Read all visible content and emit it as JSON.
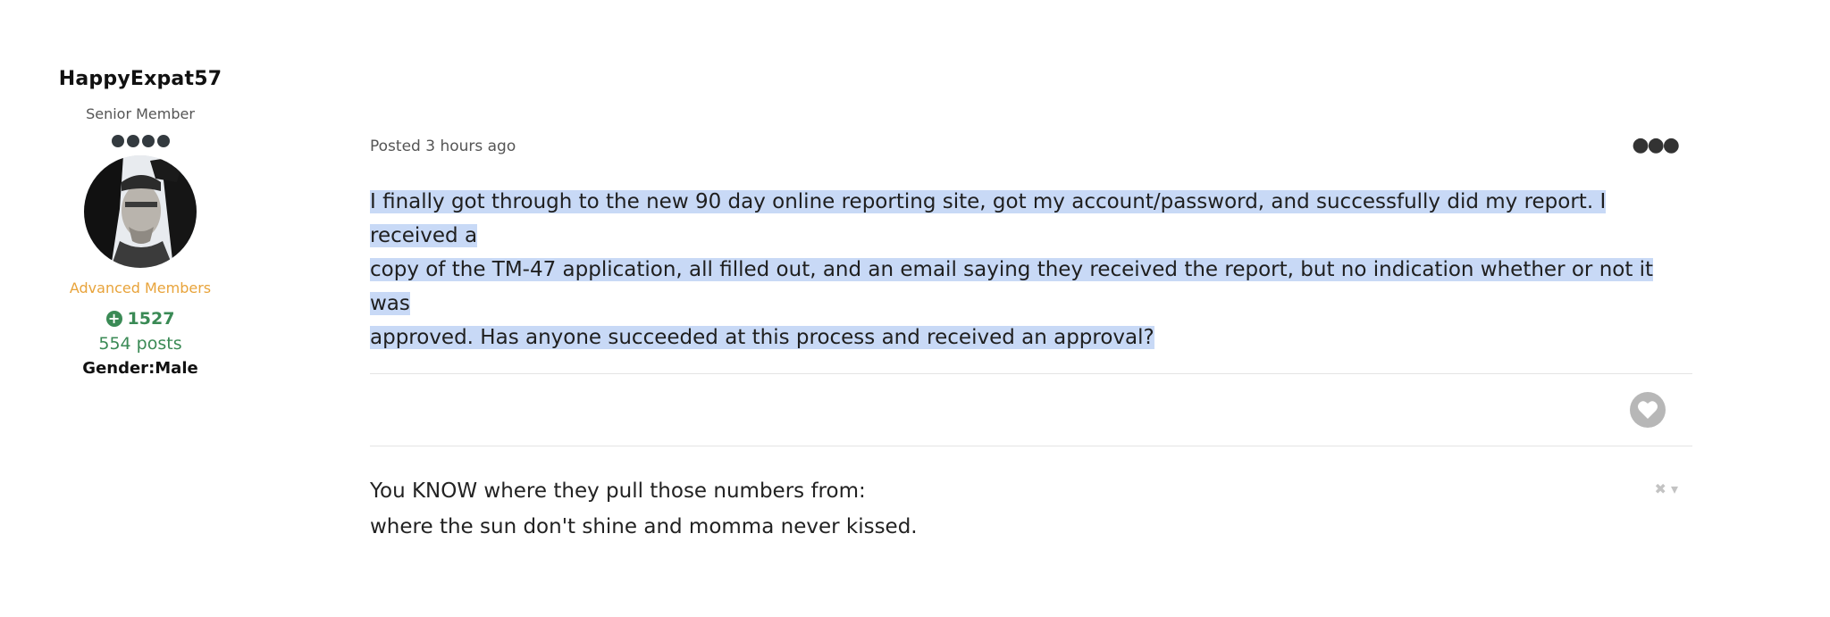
{
  "author": {
    "name": "HappyExpat57",
    "rank": "Senior Member",
    "rank_pips": 4,
    "group": "Advanced Members",
    "reputation": "1527",
    "posts": "554 posts",
    "gender": "Gender:Male"
  },
  "post": {
    "posted": "Posted 3 hours ago",
    "menu_icon": "ellipsis-icon",
    "body_lines": [
      "I finally got through to the new 90 day online reporting site, got my account/password, and successfully did my report. I received a",
      "copy of the TM-47 application, all filled out, and an email saying they received the report, but no indication whether or not it was",
      "approved. Has anyone succeeded at this process and received an approval?"
    ],
    "like_icon": "heart-icon",
    "selection_color": "#c8d9f6"
  },
  "signature": {
    "lines": [
      "You KNOW where they pull those numbers from:",
      "where the sun don't shine and momma never kissed."
    ],
    "toggle_label": "✖ ▾"
  },
  "colors": {
    "reputation": "#3a8a55",
    "group": "#e8a33a"
  }
}
